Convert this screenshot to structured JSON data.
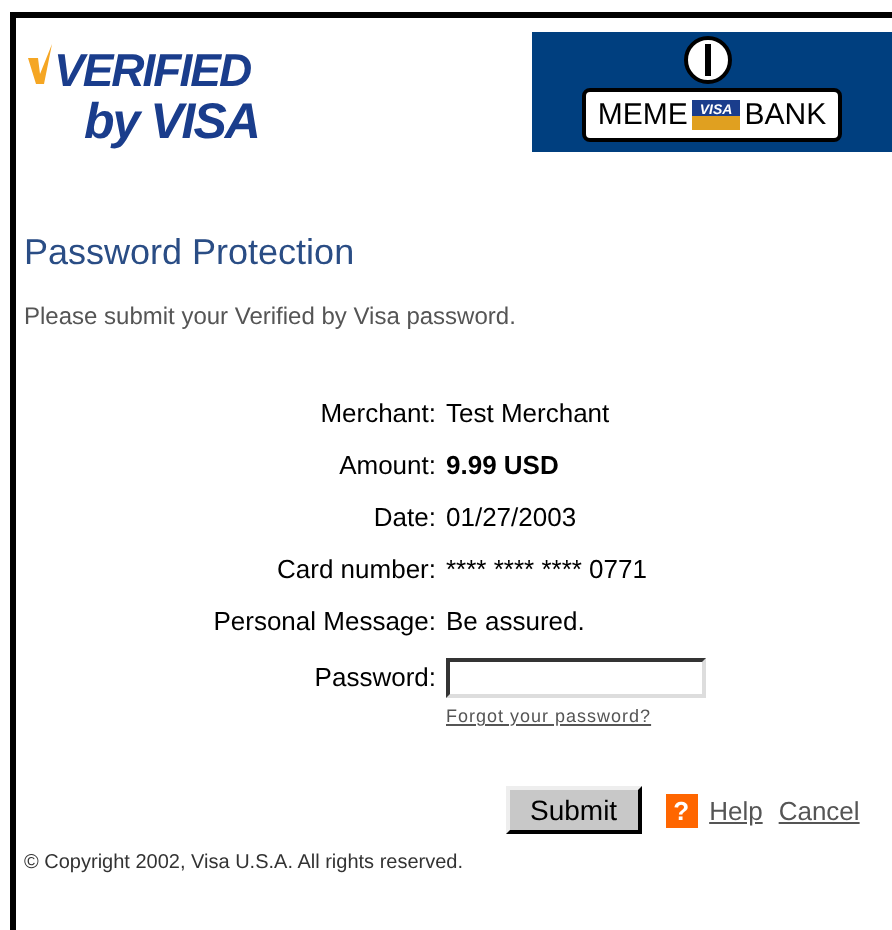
{
  "logo": {
    "line_1": "VERIFIED",
    "line_2": "by VISA"
  },
  "bank_logo": {
    "left": "MEME",
    "card": "VISA",
    "right": "BANK"
  },
  "title": "Password Protection",
  "instruction": "Please submit your Verified by Visa password.",
  "details": [
    {
      "label": "Merchant:",
      "value": "Test Merchant",
      "bold": false
    },
    {
      "label": "Amount:",
      "value": "9.99 USD",
      "bold": true
    },
    {
      "label": "Date:",
      "value": "01/27/2003",
      "bold": false
    },
    {
      "label": "Card number:",
      "value": "**** **** **** 0771",
      "bold": false
    },
    {
      "label": "Personal Message:",
      "value": "Be assured.",
      "bold": false
    }
  ],
  "password": {
    "label": "Password:",
    "forgot_link": "Forgot your password?"
  },
  "actions": {
    "submit": "Submit",
    "help_icon": "?",
    "help": "Help",
    "cancel": "Cancel"
  },
  "copyright": "© Copyright 2002, Visa U.S.A. All rights reserved."
}
